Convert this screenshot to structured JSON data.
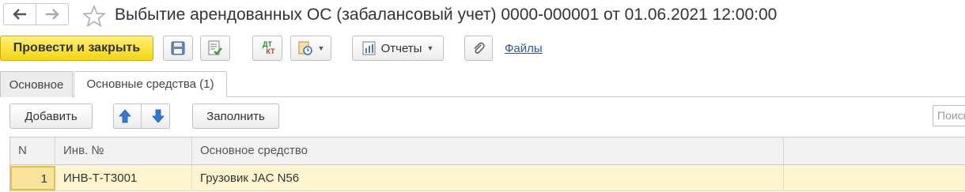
{
  "window": {
    "title": "Выбытие арендованных ОС (забалансовый учет) 0000-000001 от 01.06.2021 12:00:00"
  },
  "toolbar": {
    "post_close_label": "Провести и закрыть",
    "reports_label": "Отчеты",
    "files_label": "Файлы",
    "dt_kt_top": "ДТ",
    "dt_kt_bottom": "КТ"
  },
  "tabs": [
    {
      "label": "Основное",
      "active": false
    },
    {
      "label": "Основные средства (1)",
      "active": true
    }
  ],
  "table_toolbar": {
    "add_label": "Добавить",
    "fill_label": "Заполнить",
    "search_placeholder": "Поиск"
  },
  "table": {
    "columns": [
      "N",
      "Инв. №",
      "Основное средство"
    ],
    "rows": [
      {
        "n": "1",
        "inv": "ИНВ-Т-Т3001",
        "asset": "Грузовик JAC N56"
      }
    ]
  },
  "colors": {
    "primary_button": "#f5d50f",
    "selected_row": "#fdf5cf",
    "link": "#1f5aa8"
  }
}
